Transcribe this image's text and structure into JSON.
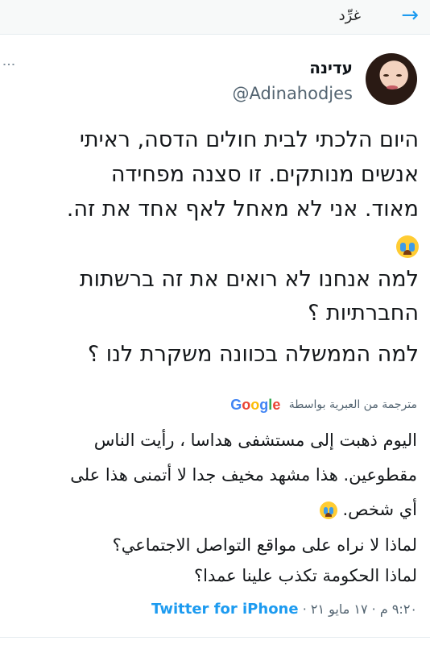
{
  "header": {
    "back_icon": "arrow-right-icon",
    "title": "غرِّد"
  },
  "tweet": {
    "display_name": "עדינה",
    "handle": "@Adinahodjes",
    "more_icon": "vertical-dots-icon",
    "original_lines": [
      "היום הלכתי לבית חולים הדסה, ראיתי",
      "אנשים מנותקים. זו סצנה מפחידה",
      "מאוד. אני לא מאחל לאף אחד את זה.",
      "למה אנחנו לא רואים את זה ברשתות",
      "החברתיות ؟",
      "למה הממשלה בכוונה משקרת לנו ؟"
    ],
    "emoji_icon": "loudly-crying-face-icon",
    "translation": {
      "label": "مترجمة من العبرية بواسطة",
      "google_g": "G",
      "google_o1": "o",
      "google_o2": "o",
      "google_g2": "g",
      "google_l": "l",
      "google_e": "e"
    },
    "translated_lines": [
      "اليوم ذهبت إلى مستشفى هداسا ، رأيت الناس",
      "مقطوعين. هذا مشهد مخيف جدا لا أتمنى هذا على",
      "أي شخص.",
      "لماذا لا نراه على مواقع التواصل الاجتماعي؟",
      "لماذا الحكومة تكذب علينا عمدا؟"
    ],
    "timestamp": "٩:٢٠ م · ١٧ مايو ٢١ ·",
    "source": "Twitter for iPhone"
  },
  "colors": {
    "accent": "#1d9bf0",
    "secondary_text": "#536471"
  }
}
